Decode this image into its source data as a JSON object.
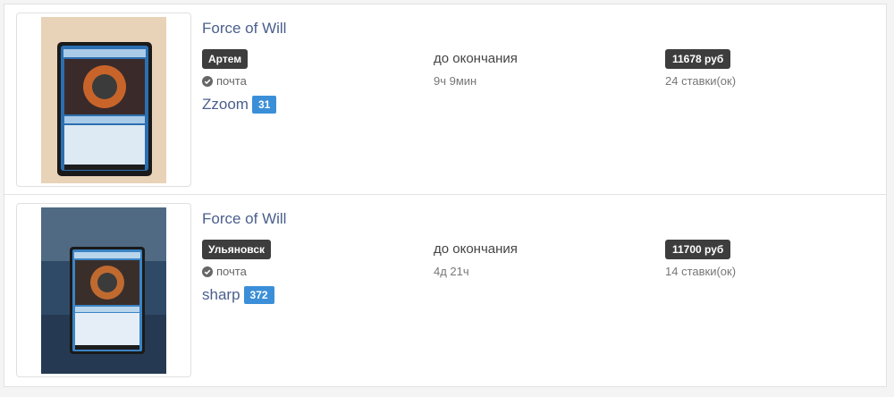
{
  "lots": [
    {
      "title": "Force of Will",
      "city": "Артем",
      "delivery": "почта",
      "ends_label": "до окончания",
      "ends_value": "9ч 9мин",
      "price": "11678 руб",
      "bids": "24 ставки(ок)",
      "seller": "Zzoom",
      "seller_rating": "31"
    },
    {
      "title": "Force of Will",
      "city": "Ульяновск",
      "delivery": "почта",
      "ends_label": "до окончания",
      "ends_value": "4д 21ч",
      "price": "11700 руб",
      "bids": "14 ставки(ок)",
      "seller": "sharp",
      "seller_rating": "372"
    }
  ],
  "colors": {
    "link": "#4a5f8c",
    "dark_badge": "#3d3d3d",
    "rating_badge": "#3b8fd8"
  },
  "icons": {
    "delivery": "check-circle-icon"
  }
}
